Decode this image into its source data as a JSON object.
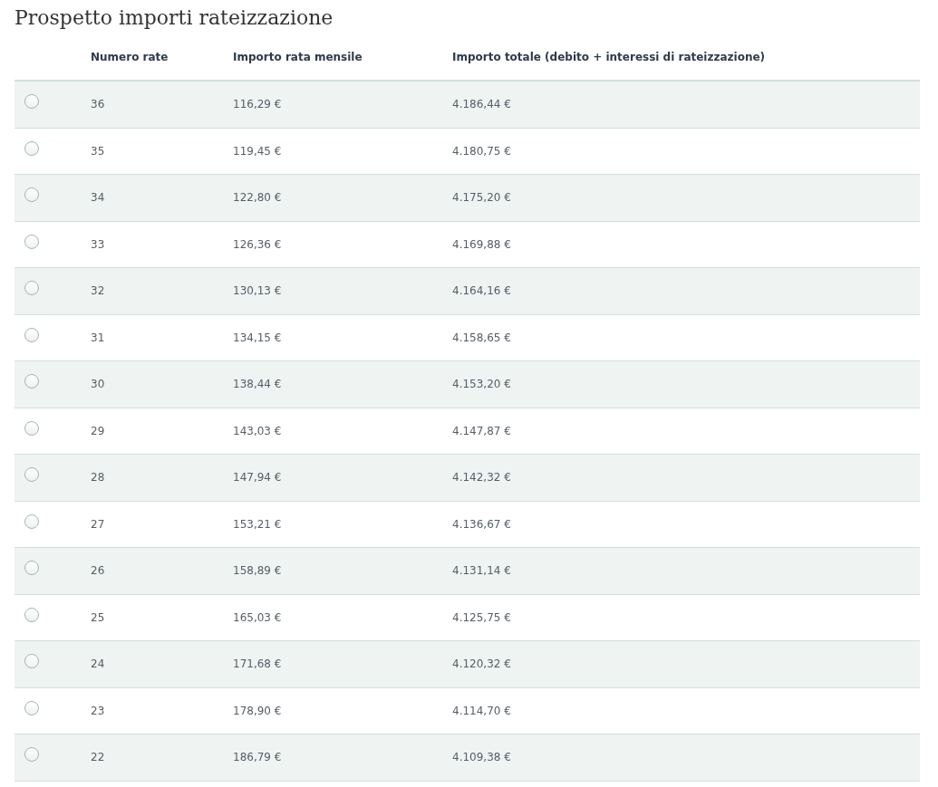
{
  "title": "Prospetto importi rateizzazione",
  "table": {
    "columns": [
      "Numero rate",
      "Importo rata mensile",
      "Importo totale (debito + interessi di rateizzazione)"
    ],
    "rows": [
      {
        "selected": false,
        "cells": [
          "36",
          "116,29 €",
          "4.186,44 €"
        ]
      },
      {
        "selected": false,
        "cells": [
          "35",
          "119,45 €",
          "4.180,75 €"
        ]
      },
      {
        "selected": false,
        "cells": [
          "34",
          "122,80 €",
          "4.175,20 €"
        ]
      },
      {
        "selected": false,
        "cells": [
          "33",
          "126,36 €",
          "4.169,88 €"
        ]
      },
      {
        "selected": false,
        "cells": [
          "32",
          "130,13 €",
          "4.164,16 €"
        ]
      },
      {
        "selected": false,
        "cells": [
          "31",
          "134,15 €",
          "4.158,65 €"
        ]
      },
      {
        "selected": false,
        "cells": [
          "30",
          "138,44 €",
          "4.153,20 €"
        ]
      },
      {
        "selected": false,
        "cells": [
          "29",
          "143,03 €",
          "4.147,87 €"
        ]
      },
      {
        "selected": false,
        "cells": [
          "28",
          "147,94 €",
          "4.142,32 €"
        ]
      },
      {
        "selected": false,
        "cells": [
          "27",
          "153,21 €",
          "4.136,67 €"
        ]
      },
      {
        "selected": false,
        "cells": [
          "26",
          "158,89 €",
          "4.131,14 €"
        ]
      },
      {
        "selected": false,
        "cells": [
          "25",
          "165,03 €",
          "4.125,75 €"
        ]
      },
      {
        "selected": false,
        "cells": [
          "24",
          "171,68 €",
          "4.120,32 €"
        ]
      },
      {
        "selected": false,
        "cells": [
          "23",
          "178,90 €",
          "4.114,70 €"
        ]
      },
      {
        "selected": false,
        "cells": [
          "22",
          "186,79 €",
          "4.109,38 €"
        ]
      }
    ]
  }
}
